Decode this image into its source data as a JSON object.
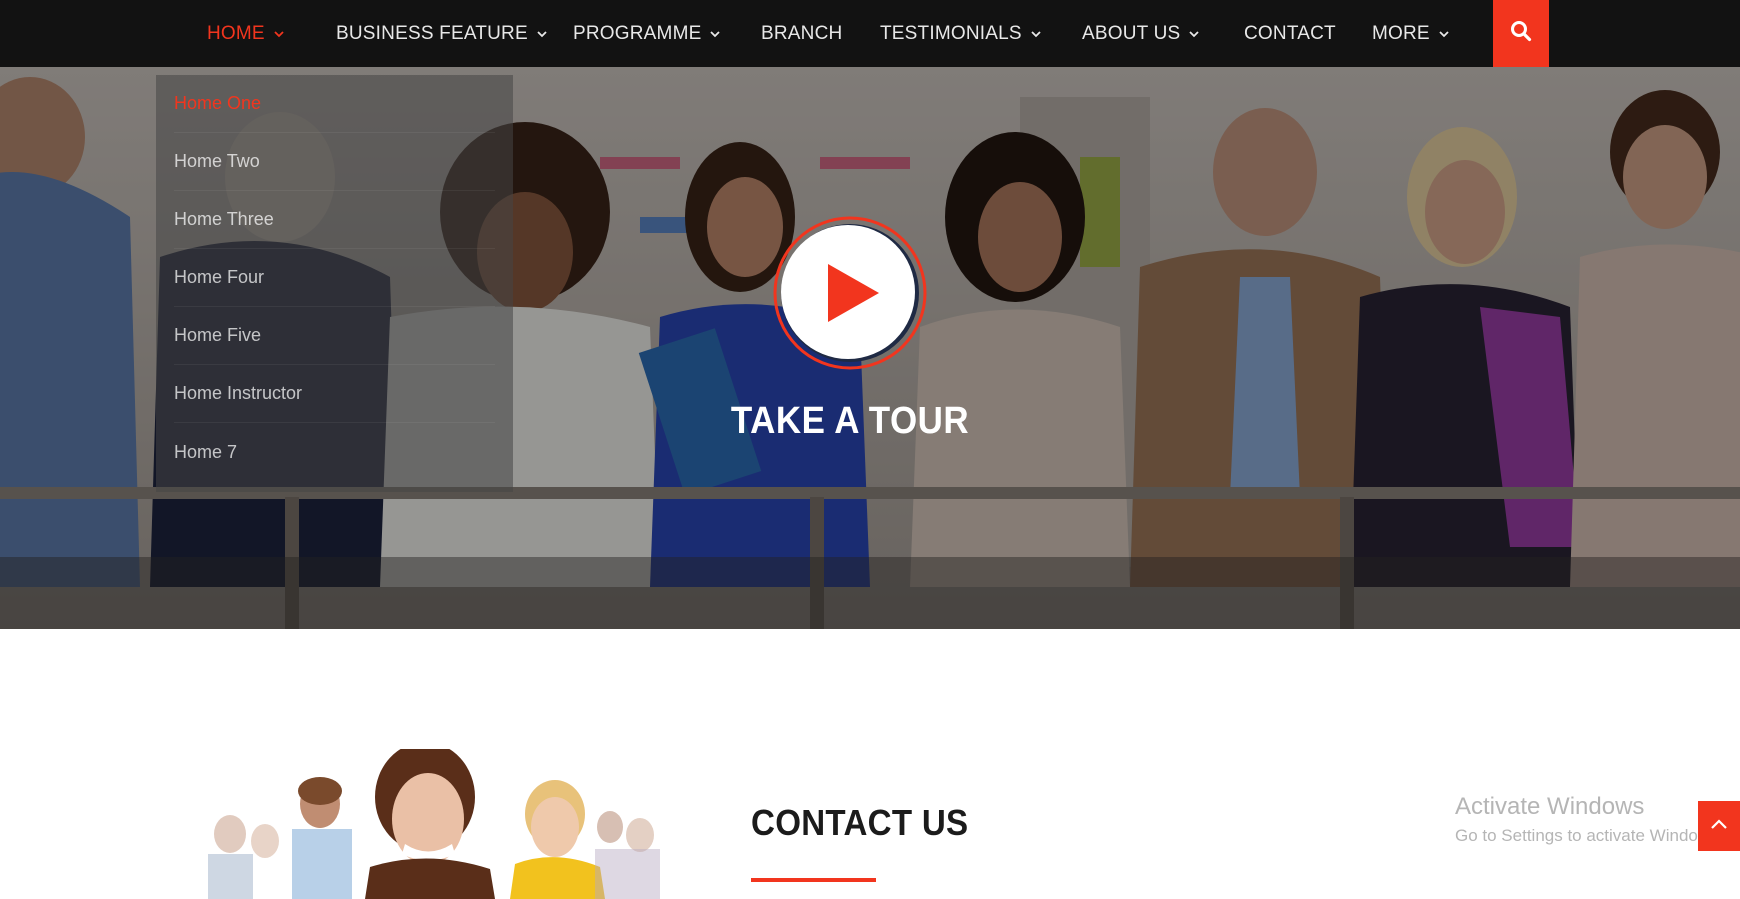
{
  "nav": {
    "items": [
      {
        "label": "HOME",
        "has_caret": true,
        "active": true
      },
      {
        "label": "BUSINESS FEATURE",
        "has_caret": true,
        "active": false
      },
      {
        "label": "PROGRAMME",
        "has_caret": true,
        "active": false
      },
      {
        "label": "BRANCH",
        "has_caret": false,
        "active": false
      },
      {
        "label": "TESTIMONIALS",
        "has_caret": true,
        "active": false
      },
      {
        "label": "ABOUT US",
        "has_caret": true,
        "active": false
      },
      {
        "label": "CONTACT",
        "has_caret": false,
        "active": false
      },
      {
        "label": "MORE",
        "has_caret": true,
        "active": false
      }
    ],
    "search_icon": "search-icon"
  },
  "home_dropdown": {
    "items": [
      {
        "label": "Home One",
        "active": true
      },
      {
        "label": "Home Two",
        "active": false
      },
      {
        "label": "Home Three",
        "active": false
      },
      {
        "label": "Home Four",
        "active": false
      },
      {
        "label": "Home Five",
        "active": false
      },
      {
        "label": "Home Instructor",
        "active": false
      },
      {
        "label": "Home 7",
        "active": false
      }
    ]
  },
  "hero": {
    "title": "TAKE A TOUR",
    "play_icon": "play-icon"
  },
  "contact": {
    "heading": "CONTACT US"
  },
  "watermark": {
    "line1": "Activate Windows",
    "line2": "Go to Settings to activate Windows."
  },
  "scroll_top_icon": "chevron-up-icon",
  "colors": {
    "accent": "#f2351e",
    "nav_bg": "#121212",
    "nav_text": "#e8e8e8"
  }
}
